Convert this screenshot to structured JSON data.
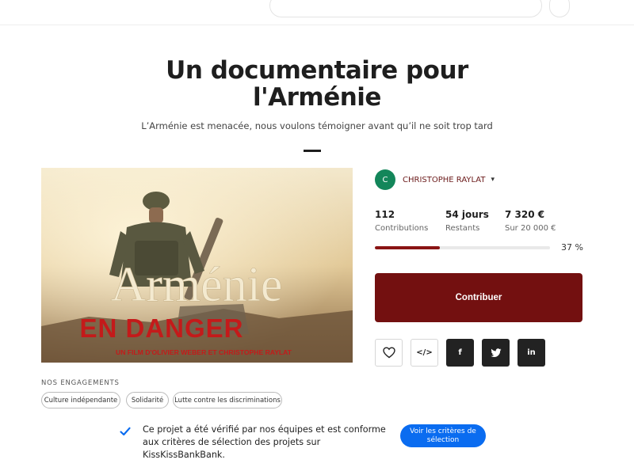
{
  "project": {
    "title": "Un documentaire pour l'Arménie",
    "subtitle": "L’Arménie est menacée, nous voulons témoigner avant qu’il ne soit trop tard"
  },
  "hero": {
    "main_text": "Arménie",
    "secondary_text": "EN DANGER",
    "credit": "UN FILM D'OLIVIER WEBER ET CHRISTOPHE RAYLAT"
  },
  "author": {
    "initial": "C",
    "name": "CHRISTOPHE RAYLAT",
    "avatar_color": "#13865a"
  },
  "stats": [
    {
      "value": "112",
      "label": "Contributions"
    },
    {
      "value": "54 jours",
      "label": "Restants"
    },
    {
      "value": "7 320 €",
      "label": "Sur 20 000 €"
    }
  ],
  "progress": {
    "percent": 37,
    "label": "37 %"
  },
  "contribute_label": "Contribuer",
  "actions": {
    "embed_label": "</>",
    "facebook_label": "f",
    "linkedin_label": "in"
  },
  "engagements": {
    "title": "NOS ENGAGEMENTS",
    "tags": [
      "Culture indépendante",
      "Solidarité",
      "Lutte contre les discriminations"
    ]
  },
  "verification": {
    "text": "Ce projet a été vérifié par nos équipes et est conforme aux critères de sélection des projets sur KissKissBankBank.",
    "button_label": "Voir les critères de sélection"
  },
  "colors": {
    "brand_dark_red": "#731010",
    "progress_red": "#8a1414",
    "link_blue": "#0a6cf0"
  }
}
